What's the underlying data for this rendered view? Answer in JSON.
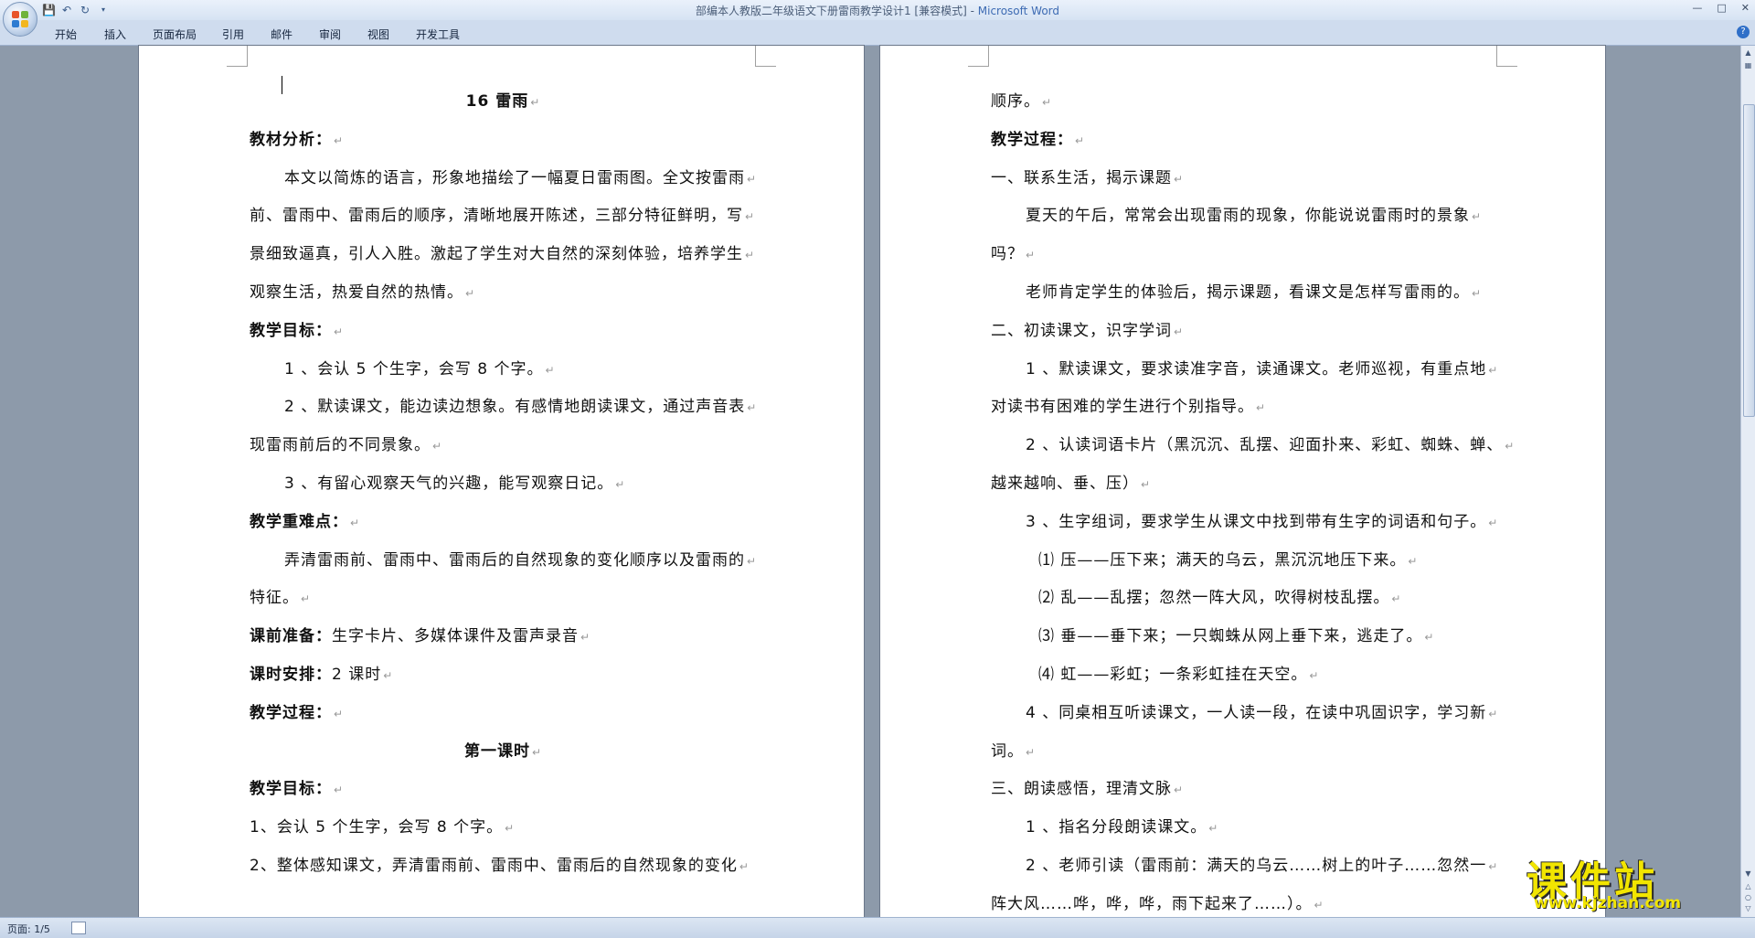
{
  "window": {
    "title": "部编本人教版二年级语文下册雷雨教学设计1 [兼容模式] - ",
    "app": "Microsoft Word"
  },
  "ribbon": {
    "tabs": [
      "开始",
      "插入",
      "页面布局",
      "引用",
      "邮件",
      "审阅",
      "视图",
      "开发工具"
    ]
  },
  "page1": {
    "lines": [
      {
        "text": "16  雷雨",
        "bold": true,
        "center": true
      },
      {
        "text": "教材分析：",
        "bold": true
      },
      {
        "text": "本文以简炼的语言，形象地描绘了一幅夏日雷雨图。全文按雷雨",
        "indent": true
      },
      {
        "text": "前、雷雨中、雷雨后的顺序，清晰地展开陈述，三部分特征鲜明，写"
      },
      {
        "text": "景细致逼真，引人入胜。激起了学生对大自然的深刻体验，培养学生"
      },
      {
        "text": "观察生活，热爱自然的热情。"
      },
      {
        "text": "教学目标：",
        "bold": true
      },
      {
        "text": "1 、会认 5 个生字，会写 8 个字。",
        "indent": true
      },
      {
        "text": "2 、默读课文，能边读边想象。有感情地朗读课文，通过声音表",
        "indent": true
      },
      {
        "text": "现雷雨前后的不同景象。"
      },
      {
        "text": "3 、有留心观察天气的兴趣，能写观察日记。",
        "indent": true
      },
      {
        "text": "教学重难点：",
        "bold": true
      },
      {
        "text": "弄清雷雨前、雷雨中、雷雨后的自然现象的变化顺序以及雷雨的",
        "indent": true
      },
      {
        "text": "特征。"
      },
      {
        "text": "课前准备：",
        "bold": true,
        "rest": "生字卡片、多媒体课件及雷声录音"
      },
      {
        "text": "课时安排：",
        "bold": true,
        "rest": "2 课时"
      },
      {
        "text": "教学过程：",
        "bold": true
      },
      {
        "text": "第一课时",
        "bold": true,
        "center": true
      },
      {
        "text": "教学目标：",
        "bold": true
      },
      {
        "text": "1、会认 5 个生字，会写 8 个字。"
      },
      {
        "text": "2、整体感知课文，弄清雷雨前、雷雨中、雷雨后的自然现象的变化"
      }
    ]
  },
  "page2": {
    "lines": [
      {
        "text": "顺序。"
      },
      {
        "text": "教学过程：",
        "bold": true
      },
      {
        "text": "一、联系生活，揭示课题"
      },
      {
        "text": "夏天的午后，常常会出现雷雨的现象，你能说说雷雨时的景象",
        "indent": true
      },
      {
        "text": "吗？"
      },
      {
        "text": "老师肯定学生的体验后，揭示课题，看课文是怎样写雷雨的。",
        "indent": true
      },
      {
        "text": "二、初读课文，识字学词"
      },
      {
        "text": "1 、默读课文，要求读准字音，读通课文。老师巡视，有重点地",
        "indent": true
      },
      {
        "text": "对读书有困难的学生进行个别指导。"
      },
      {
        "text": "2 、认读词语卡片（黑沉沉、乱摆、迎面扑来、彩虹、蜘蛛、蝉、",
        "indent": true
      },
      {
        "text": "越来越响、垂、压）"
      },
      {
        "text": "3 、生字组词，要求学生从课文中找到带有生字的词语和句子。",
        "indent": true
      },
      {
        "text": "⑴  压——压下来；满天的乌云，黑沉沉地压下来。",
        "indent2": true
      },
      {
        "text": "⑵  乱——乱摆；忽然一阵大风，吹得树枝乱摆。",
        "indent2": true
      },
      {
        "text": "⑶  垂——垂下来；一只蜘蛛从网上垂下来，逃走了。",
        "indent2": true
      },
      {
        "text": "⑷  虹——彩虹；一条彩虹挂在天空。",
        "indent2": true
      },
      {
        "text": "4 、同桌相互听读课文，一人读一段，在读中巩固识字，学习新",
        "indent": true
      },
      {
        "text": "词。"
      },
      {
        "text": "三、朗读感悟，理清文脉"
      },
      {
        "text": "1 、指名分段朗读课文。",
        "indent": true
      },
      {
        "text": "2 、老师引读（雷雨前：满天的乌云……树上的叶子……忽然一",
        "indent": true
      },
      {
        "text": "阵大风……哗，哗，哗，雨下起来了……）。"
      }
    ]
  },
  "status": {
    "page": "页面: 1/5"
  },
  "watermark": {
    "main": "课件站",
    "url": "www.kjzhan.com"
  },
  "colors": {
    "ribbon": "#cfdcee",
    "workspace": "#8d9aaa",
    "watermark": "#f2e500"
  }
}
